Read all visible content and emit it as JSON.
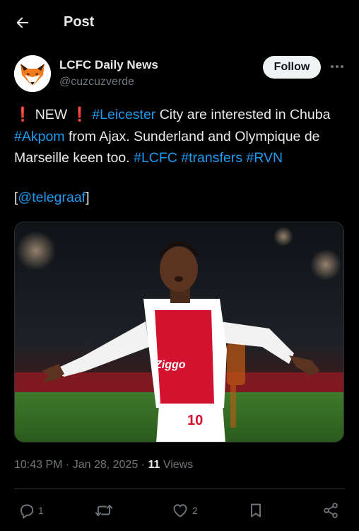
{
  "header": {
    "title": "Post",
    "back_icon": "arrow-left-icon"
  },
  "author": {
    "name": "LCFC Daily News",
    "handle": "@cuzcuzverde",
    "follow_label": "Follow",
    "more_icon": "more-horizontal-icon"
  },
  "post": {
    "excl1": "❗",
    "word_new": " NEW ",
    "excl2": "❗",
    "hash_leicester": "#Leicester",
    "text1": " City are interested in Chuba ",
    "hash_akpom": "#Akpom",
    "text2": " from Ajax. Sunderland and Olympique de Marseille keen too. ",
    "hash_lcfc": "#LCFC",
    "space1": " ",
    "hash_transfers": "#transfers",
    "space2": " ",
    "hash_rvn": "#RVN",
    "source_open": "[",
    "source_handle": "@telegraaf",
    "source_close": "]"
  },
  "media": {
    "shirt_sponsor": "Ziggo",
    "shirt_number": "10"
  },
  "meta": {
    "time": "10:43 PM",
    "sep1": " · ",
    "date": "Jan 28, 2025",
    "sep2": " · ",
    "views_count": "11",
    "views_label": " Views"
  },
  "actions": {
    "reply_count": "1",
    "repost_count": "",
    "like_count": "2"
  },
  "colors": {
    "background": "#000000",
    "text": "#e7e9ea",
    "secondary": "#71767b",
    "link": "#1d9bf0",
    "accent_red": "#e0245e"
  }
}
